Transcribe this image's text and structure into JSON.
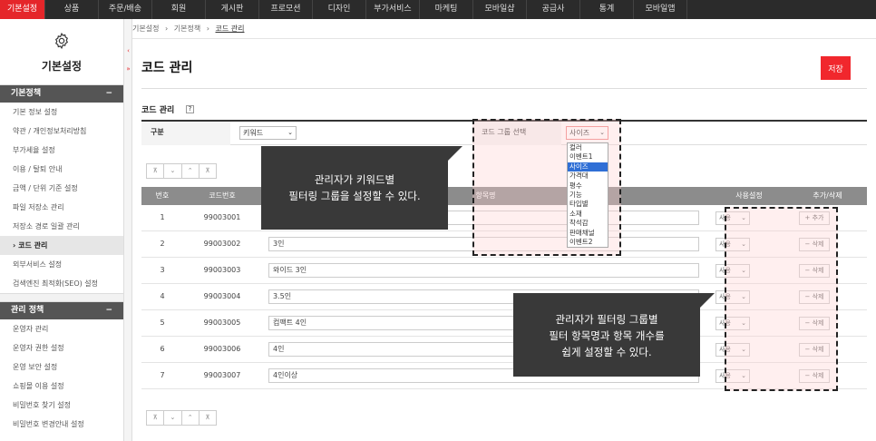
{
  "topnav": [
    "기본설정",
    "상품",
    "주문/배송",
    "회원",
    "게시판",
    "프로모션",
    "디자인",
    "부가서비스",
    "마케팅",
    "모바일샵",
    "공급사",
    "통계",
    "모바일앱"
  ],
  "sidebar": {
    "title": "기본설정",
    "section1": {
      "label": "기본정책",
      "toggle": "−"
    },
    "items1": [
      "기본 정보 설정",
      "약관 / 개인정보처리방침",
      "부가세율 설정",
      "이용 / 탈퇴 안내",
      "금액 / 단위 기준 설정",
      "파일 저장소 관리",
      "저장소 경로 일괄 관리",
      "› 코드 관리",
      "외부서비스 설정",
      "검색엔진 최적화(SEO) 설정"
    ],
    "section2": {
      "label": "관리 정책",
      "toggle": "−"
    },
    "items2": [
      "운영자 관리",
      "운영자 권한 설정",
      "운영 보안 설정",
      "쇼핑몰 이용 설정",
      "비밀번호 찾기 설정",
      "비밀번호 변경안내 설정"
    ]
  },
  "breadcrumb": [
    "기본설정",
    "›",
    "기본정책",
    "›",
    "코드 관리"
  ],
  "page": {
    "title": "코드 관리",
    "save_label": "저장",
    "section_title": "코드 관리",
    "help": "?"
  },
  "filter": {
    "category_label": "구분",
    "category_value": "키워드",
    "group_label": "코드 그룹 선택",
    "group_value": "사이즈",
    "group_options": [
      "컬러",
      "이벤트1",
      "사이즈",
      "가격대",
      "평수",
      "기능",
      "타입별",
      "소재",
      "착석감",
      "판매채널",
      "이벤트2"
    ]
  },
  "toolbar": [
    "⊼",
    "⌄",
    "⌃",
    "⊼"
  ],
  "table": {
    "headers": [
      "번호",
      "코드번호",
      "항목명",
      "사용설정",
      "추가/삭제"
    ],
    "rows": [
      {
        "no": "1",
        "code": "99003001",
        "name": "",
        "use": "사용",
        "action": "+ 추가"
      },
      {
        "no": "2",
        "code": "99003002",
        "name": "3인",
        "use": "사용",
        "action": "− 삭제"
      },
      {
        "no": "3",
        "code": "99003003",
        "name": "와이드 3인",
        "use": "사용",
        "action": "− 삭제"
      },
      {
        "no": "4",
        "code": "99003004",
        "name": "3.5인",
        "use": "사용",
        "action": "− 삭제"
      },
      {
        "no": "5",
        "code": "99003005",
        "name": "컴팩트 4인",
        "use": "사용",
        "action": "− 삭제"
      },
      {
        "no": "6",
        "code": "99003006",
        "name": "4인",
        "use": "사용",
        "action": "− 삭제"
      },
      {
        "no": "7",
        "code": "99003007",
        "name": "4인이상",
        "use": "사용",
        "action": "− 삭제"
      }
    ]
  },
  "callouts": {
    "c1": [
      "관리자가 키워드별",
      "필터링 그룹을 설정할 수 있다."
    ],
    "c2": [
      "관리자가 필터링 그룹별",
      "필터 항목명과 항목 개수를",
      "쉽게 설정할 수 있다."
    ]
  },
  "colors": {
    "accent": "#e5262a",
    "nav_bg": "#2b2b2b",
    "callout_bg": "#393939",
    "header_bg": "#8c8c8c"
  }
}
